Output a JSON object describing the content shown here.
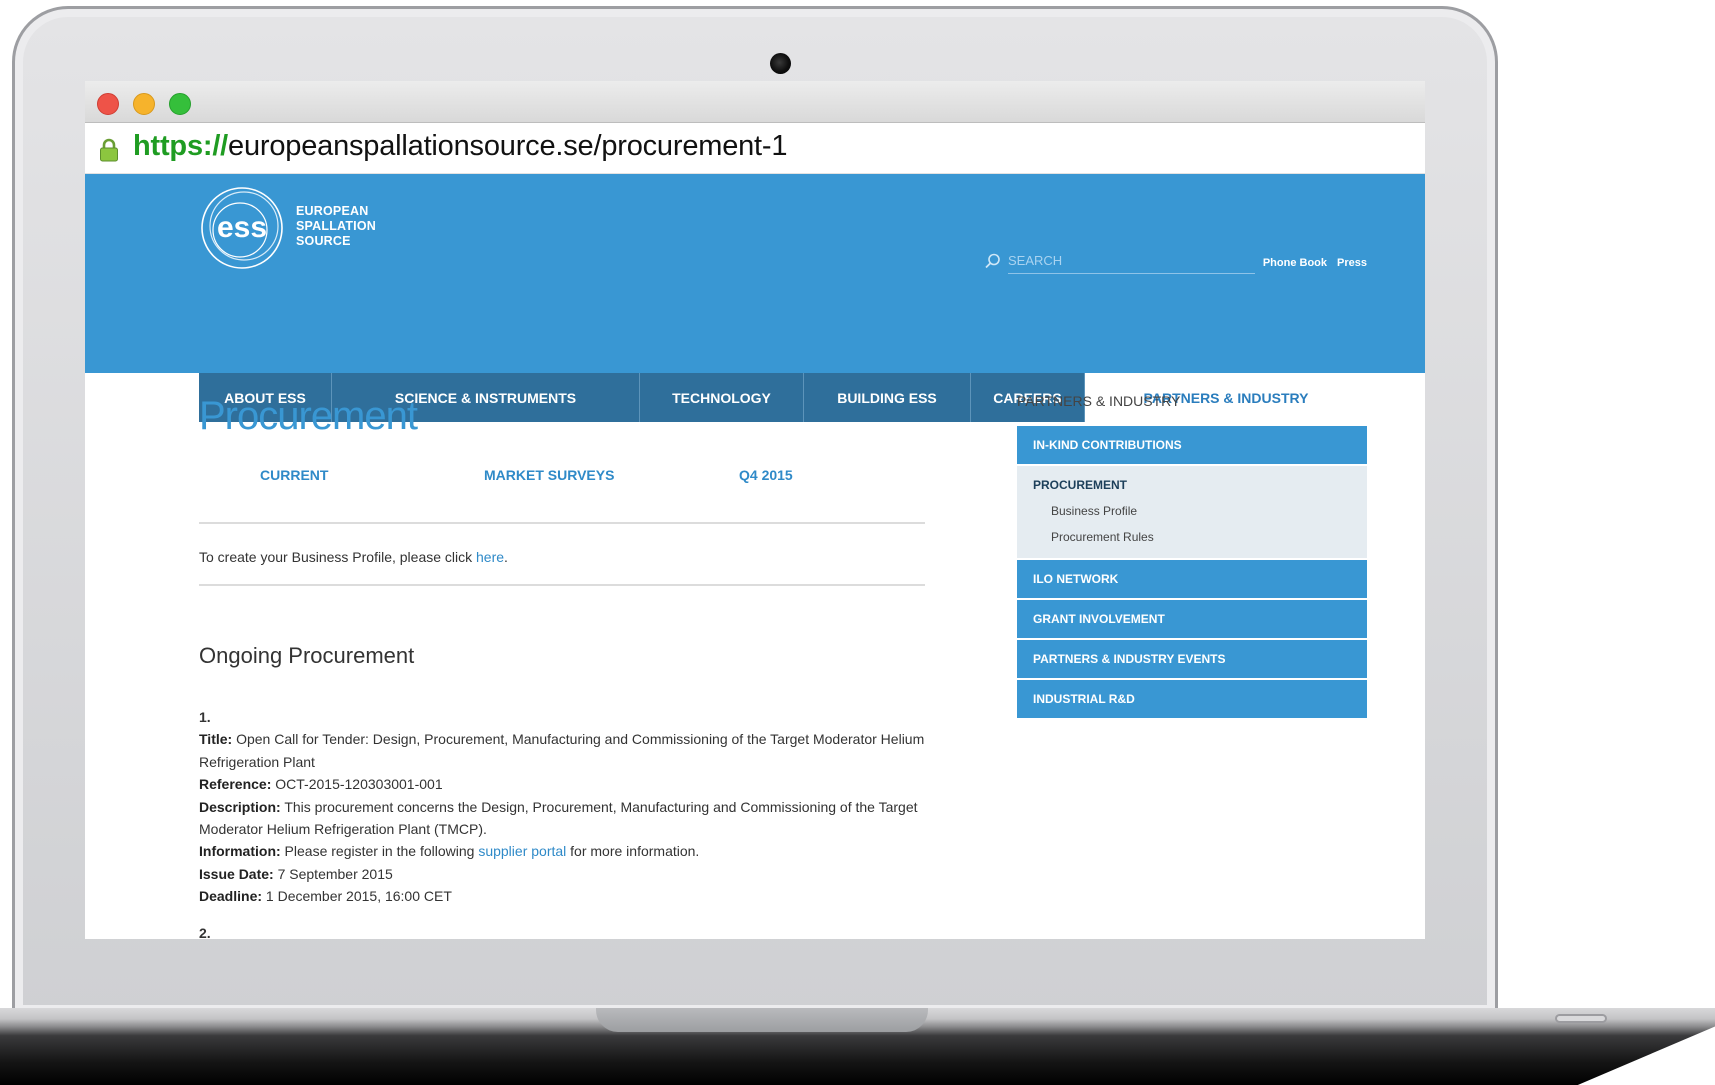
{
  "browser": {
    "url_scheme": "https://",
    "url_rest": "europeanspallationsource.se/procurement-1"
  },
  "header": {
    "logo_lines": [
      "EUROPEAN",
      "SPALLATION",
      "SOURCE"
    ],
    "search_placeholder": "SEARCH",
    "utility_links": [
      "Phone Book",
      "Press"
    ]
  },
  "nav": {
    "items": [
      {
        "label": "ABOUT ESS"
      },
      {
        "label": "SCIENCE & INSTRUMENTS"
      },
      {
        "label": "TECHNOLOGY"
      },
      {
        "label": "BUILDING ESS"
      },
      {
        "label": "CAREERS"
      },
      {
        "label": "PARTNERS & INDUSTRY"
      }
    ],
    "active": "PARTNERS & INDUSTRY"
  },
  "main": {
    "title": "Procurement",
    "tabs": [
      {
        "label": "CURRENT"
      },
      {
        "label": "MARKET SURVEYS"
      },
      {
        "label": "Q4 2015"
      }
    ],
    "intro_prefix": "To create your Business Profile, please click ",
    "intro_link": "here",
    "intro_suffix": ".",
    "section_heading": "Ongoing Procurement",
    "item1": {
      "number": "1.",
      "title_label": "Title:",
      "title": " Open Call for Tender: Design, Procurement, Manufacturing and Commissioning of the Target Moderator Helium Refrigeration Plant",
      "reference_label": "Reference:",
      "reference": " OCT-2015-120303001-001",
      "description_label": "Description:",
      "description": " This procurement concerns the Design, Procurement, Manufacturing and Commissioning of the Target Moderator Helium Refrigeration Plant (TMCP).",
      "information_label": "Information:",
      "information_prefix": " Please register in the following ",
      "information_link": "supplier portal",
      "information_suffix": " for more information.",
      "issue_label": "Issue Date:",
      "issue": " 7 September 2015",
      "deadline_label": "Deadline:",
      "deadline": " 1 December 2015, 16:00 CET"
    },
    "item2_number": "2."
  },
  "sidebar": {
    "heading": "PARTNERS & INDUSTRY",
    "items": [
      {
        "label": "IN-KIND CONTRIBUTIONS"
      },
      {
        "label": "PROCUREMENT"
      },
      {
        "label": "ILO NETWORK"
      },
      {
        "label": "GRANT INVOLVEMENT"
      },
      {
        "label": "PARTNERS & INDUSTRY EVENTS"
      },
      {
        "label": "INDUSTRIAL R&D"
      }
    ],
    "procurement_children": [
      "Business Profile",
      "Procurement Rules"
    ]
  },
  "colors": {
    "brand_blue": "#3997d3",
    "nav_dark_blue": "#2f6f9b",
    "link_blue": "#2f8ac8",
    "url_green": "#1f9c22"
  }
}
